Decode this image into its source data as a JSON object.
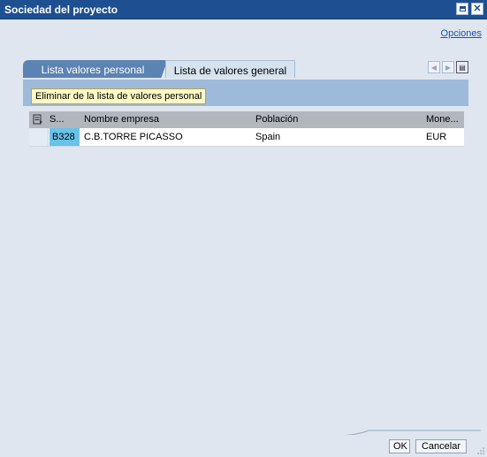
{
  "window": {
    "title": "Sociedad del proyecto",
    "maximize_icon": "maximize-icon",
    "close_icon": "close-icon",
    "close_glyph": "✕"
  },
  "options_link": "Opciones",
  "tabs": [
    {
      "label": "Lista valores personal",
      "active": true
    },
    {
      "label": "Lista de valores general",
      "active": false
    }
  ],
  "tab_scroll": {
    "left_glyph": "◀",
    "right_glyph": "▶",
    "list_glyph": "▤"
  },
  "toolbar": {
    "delete_label": "Eliminar de la lista de valores personal"
  },
  "table": {
    "columns": [
      "S...",
      "Nombre empresa",
      "Población",
      "Mone..."
    ],
    "rows": [
      {
        "key": "B328",
        "name": "C.B.TORRE PICASSO",
        "population": "Spain",
        "currency": "EUR"
      }
    ]
  },
  "buttons": {
    "ok": "OK",
    "cancel": "Cancelar"
  },
  "colors": {
    "titlebar": "#1e4f91",
    "active_tab": "#5b83b3",
    "header_strip": "#9ebadb",
    "selected_cell": "#69c2e8",
    "delete_button_bg": "#fff8c4"
  }
}
